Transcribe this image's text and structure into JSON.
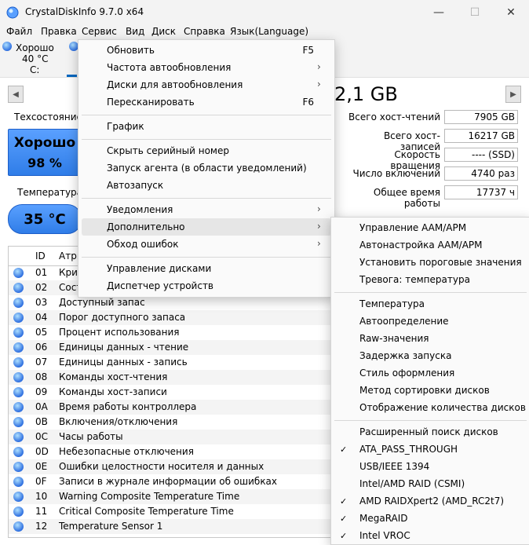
{
  "window": {
    "title": "CrystalDiskInfo 9.7.0 x64",
    "minimize": "—",
    "maximize": "☐",
    "close": "✕"
  },
  "menu": [
    "Файл",
    "Правка",
    "Сервис",
    "Вид",
    "Диск",
    "Справка",
    "Язык(Language)"
  ],
  "disk_tab": {
    "status": "Хорошо",
    "temp": "40 °C",
    "drive": "C:"
  },
  "capacity": "2,1 GB",
  "health": {
    "label": "Техсостояние",
    "status": "Хорошо",
    "percent": "98 %"
  },
  "temperature": {
    "label": "Температура",
    "value": "35 °C"
  },
  "stats": [
    {
      "label": "Всего хост-чтений",
      "value": "7905 GB"
    },
    {
      "label": "Всего хост-записей",
      "value": "16217 GB"
    },
    {
      "label": "Скорость вращения",
      "value": "---- (SSD)"
    },
    {
      "label": "Число включений",
      "value": "4740 раз"
    },
    {
      "label": "Общее время работы",
      "value": "17737 ч"
    }
  ],
  "table": {
    "headers": {
      "id": "ID",
      "name": "Атри"
    },
    "rows": [
      {
        "id": "01",
        "name": "Крит"
      },
      {
        "id": "02",
        "name": "Сост"
      },
      {
        "id": "03",
        "name": "Доступный запас"
      },
      {
        "id": "04",
        "name": "Порог доступного запаса"
      },
      {
        "id": "05",
        "name": "Процент использования"
      },
      {
        "id": "06",
        "name": "Единицы данных - чтение"
      },
      {
        "id": "07",
        "name": "Единицы данных - запись"
      },
      {
        "id": "08",
        "name": "Команды хост-чтения"
      },
      {
        "id": "09",
        "name": "Команды хост-записи"
      },
      {
        "id": "0A",
        "name": "Время работы контроллера"
      },
      {
        "id": "0B",
        "name": "Включения/отключения"
      },
      {
        "id": "0C",
        "name": "Часы работы"
      },
      {
        "id": "0D",
        "name": "Небезопасные отключения"
      },
      {
        "id": "0E",
        "name": "Ошибки целостности носителя и данных"
      },
      {
        "id": "0F",
        "name": "Записи в журнале информации об ошибках"
      },
      {
        "id": "10",
        "name": "Warning Composite Temperature Time"
      },
      {
        "id": "11",
        "name": "Critical Composite Temperature Time"
      },
      {
        "id": "12",
        "name": "Temperature Sensor 1"
      }
    ]
  },
  "service_menu": {
    "refresh": {
      "label": "Обновить",
      "shortcut": "F5"
    },
    "autorefresh_freq": "Частота автообновления",
    "autorefresh_disks": "Диски для автообновления",
    "rescan": {
      "label": "Пересканировать",
      "shortcut": "F6"
    },
    "graph": "График",
    "hide_serial": "Скрыть серийный номер",
    "agent": "Запуск агента (в области уведомлений)",
    "autostart": "Автозапуск",
    "notifications": "Уведомления",
    "advanced": "Дополнительно",
    "error_bypass": "Обход ошибок",
    "disk_mgmt": "Управление дисками",
    "device_mgr": "Диспетчер устройств"
  },
  "advanced_menu": {
    "items": [
      {
        "label": "Управление AAM/APM",
        "checked": false
      },
      {
        "label": "Автонастройка AAM/APM",
        "checked": false
      },
      {
        "label": "Установить пороговые значения",
        "checked": false
      },
      {
        "label": "Тревога: температура",
        "checked": false
      },
      {
        "label": "Температура",
        "checked": false
      },
      {
        "label": "Автоопределение",
        "checked": false
      },
      {
        "label": "Raw-значения",
        "checked": false
      },
      {
        "label": "Задержка запуска",
        "checked": false
      },
      {
        "label": "Стиль оформления",
        "checked": false
      },
      {
        "label": "Метод сортировки дисков",
        "checked": false
      },
      {
        "label": "Отображение количества дисков",
        "checked": false
      },
      {
        "label": "Расширенный поиск дисков",
        "checked": false
      },
      {
        "label": "ATA_PASS_THROUGH",
        "checked": true
      },
      {
        "label": "USB/IEEE 1394",
        "checked": false
      },
      {
        "label": "Intel/AMD RAID (CSMI)",
        "checked": false
      },
      {
        "label": "AMD RAIDXpert2 (AMD_RC2t7)",
        "checked": true
      },
      {
        "label": "MegaRAID",
        "checked": true
      },
      {
        "label": "Intel VROC",
        "checked": true
      }
    ],
    "check_glyph": "✓"
  },
  "icons": {
    "submenu_arrow": "›",
    "nav_prev": "◀",
    "nav_next": "▶"
  },
  "colors": {
    "health_blue": "#2f7de8",
    "accent": "#0067c0"
  }
}
